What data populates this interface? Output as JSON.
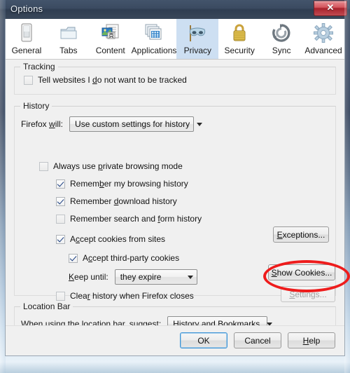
{
  "window": {
    "title": "Options",
    "close_label": "✕"
  },
  "tabs": [
    {
      "label": "General",
      "icon": "general-icon",
      "selected": false
    },
    {
      "label": "Tabs",
      "icon": "tabs-icon",
      "selected": false
    },
    {
      "label": "Content",
      "icon": "content-icon",
      "selected": false
    },
    {
      "label": "Applications",
      "icon": "applications-icon",
      "selected": false
    },
    {
      "label": "Privacy",
      "icon": "privacy-mask-icon",
      "selected": true
    },
    {
      "label": "Security",
      "icon": "security-lock-icon",
      "selected": false
    },
    {
      "label": "Sync",
      "icon": "sync-icon",
      "selected": false
    },
    {
      "label": "Advanced",
      "icon": "advanced-gear-icon",
      "selected": false
    }
  ],
  "tracking": {
    "group_title": "Tracking",
    "do_not_track": {
      "label_pre": "Tell websites I ",
      "label_accel": "d",
      "label_post": "o not want to be tracked",
      "checked": false
    }
  },
  "history": {
    "group_title": "History",
    "firefox_will": {
      "label_pre": "Firefox ",
      "label_accel": "w",
      "label_post": "ill:",
      "value": "Use custom settings for history"
    },
    "options": [
      {
        "label_pre": "Always use ",
        "label_accel": "p",
        "label_post": "rivate browsing mode",
        "checked": false
      },
      {
        "label_pre": "Remem",
        "label_accel": "b",
        "label_post": "er my browsing history",
        "checked": true
      },
      {
        "label_pre": "Remember ",
        "label_accel": "d",
        "label_post": "ownload history",
        "checked": true
      },
      {
        "label_pre": "Remember search and ",
        "label_accel": "f",
        "label_post": "orm history",
        "checked": false
      },
      {
        "label_pre": "A",
        "label_accel": "c",
        "label_post": "cept cookies from sites",
        "checked": true
      },
      {
        "label_pre": "A",
        "label_accel": "c",
        "label_post": "cept third-party cookies",
        "checked": true
      },
      {
        "label_pre": "Clea",
        "label_accel": "r",
        "label_post": " history when Firefox closes",
        "checked": false
      }
    ],
    "keep_until": {
      "label_accel": "K",
      "label_post": "eep until:",
      "value": "they expire"
    },
    "buttons": {
      "exceptions": {
        "accel": "E",
        "rest": "xceptions...",
        "disabled": false
      },
      "show_cookies": {
        "accel": "S",
        "rest": "how Cookies...",
        "disabled": false,
        "highlighted": true
      },
      "settings": {
        "accel": "S",
        "rest": "ettings...",
        "disabled": true
      }
    }
  },
  "location_bar": {
    "group_title": "Location Bar",
    "suggest": {
      "label_pre": "When ",
      "label_accel": "u",
      "label_post": "sing the location bar, suggest:",
      "value": "History and Bookmarks"
    }
  },
  "dialog_buttons": {
    "ok": {
      "label": "OK",
      "default": true
    },
    "cancel": {
      "label": "Cancel",
      "default": false
    },
    "help": {
      "accel": "H",
      "rest": "elp",
      "default": false
    }
  },
  "annotation": {
    "color": "#ee1c1c",
    "target": "show-cookies-button"
  }
}
